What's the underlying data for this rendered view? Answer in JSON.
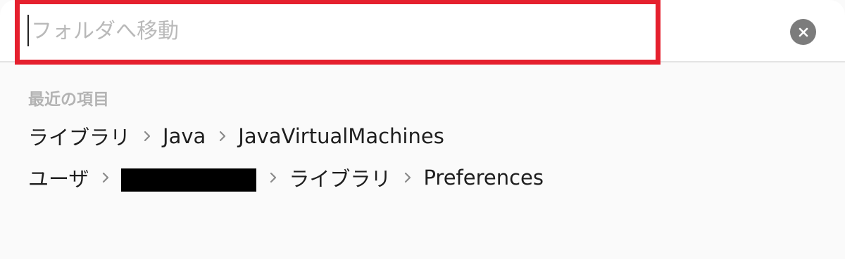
{
  "search": {
    "placeholder": "フォルダへ移動",
    "value": ""
  },
  "recent": {
    "title": "最近の項目",
    "items": [
      {
        "segments": [
          "ライブラリ",
          "Java",
          "JavaVirtualMachines"
        ]
      },
      {
        "segments": [
          "ユーザ",
          "",
          "ライブラリ",
          "Preferences"
        ]
      }
    ]
  },
  "icons": {
    "clear": "close-circle-icon",
    "separator": "chevron-right-icon"
  },
  "colors": {
    "highlight": "#e5202e",
    "placeholder": "#b9b9b9",
    "section_title": "#b3b3b3",
    "clear_button": "#7c7c7c"
  }
}
